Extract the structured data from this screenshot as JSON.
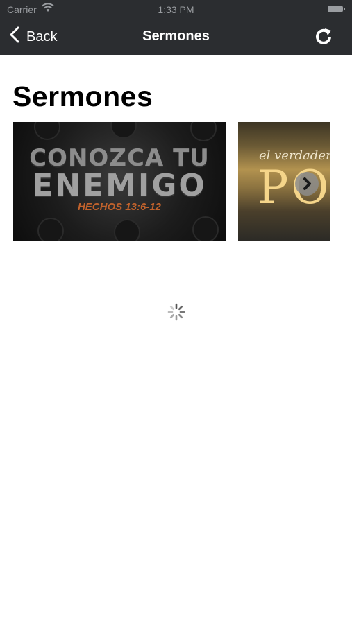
{
  "status_bar": {
    "carrier": "Carrier",
    "time": "1:33 PM"
  },
  "nav_bar": {
    "back_label": "Back",
    "title": "Sermones",
    "refresh_icon": "refresh-icon"
  },
  "section": {
    "heading": "Sermones"
  },
  "sermons": [
    {
      "title_line1": "CONOZCA TU",
      "title_line2": "ENEMIGO",
      "reference": "HECHOS 13:6-12"
    },
    {
      "script_text": "el verdader",
      "big_text": "PO"
    }
  ],
  "colors": {
    "nav_background": "#2b2d30",
    "page_background": "#ffffff",
    "reference_orange": "#c1622c"
  }
}
